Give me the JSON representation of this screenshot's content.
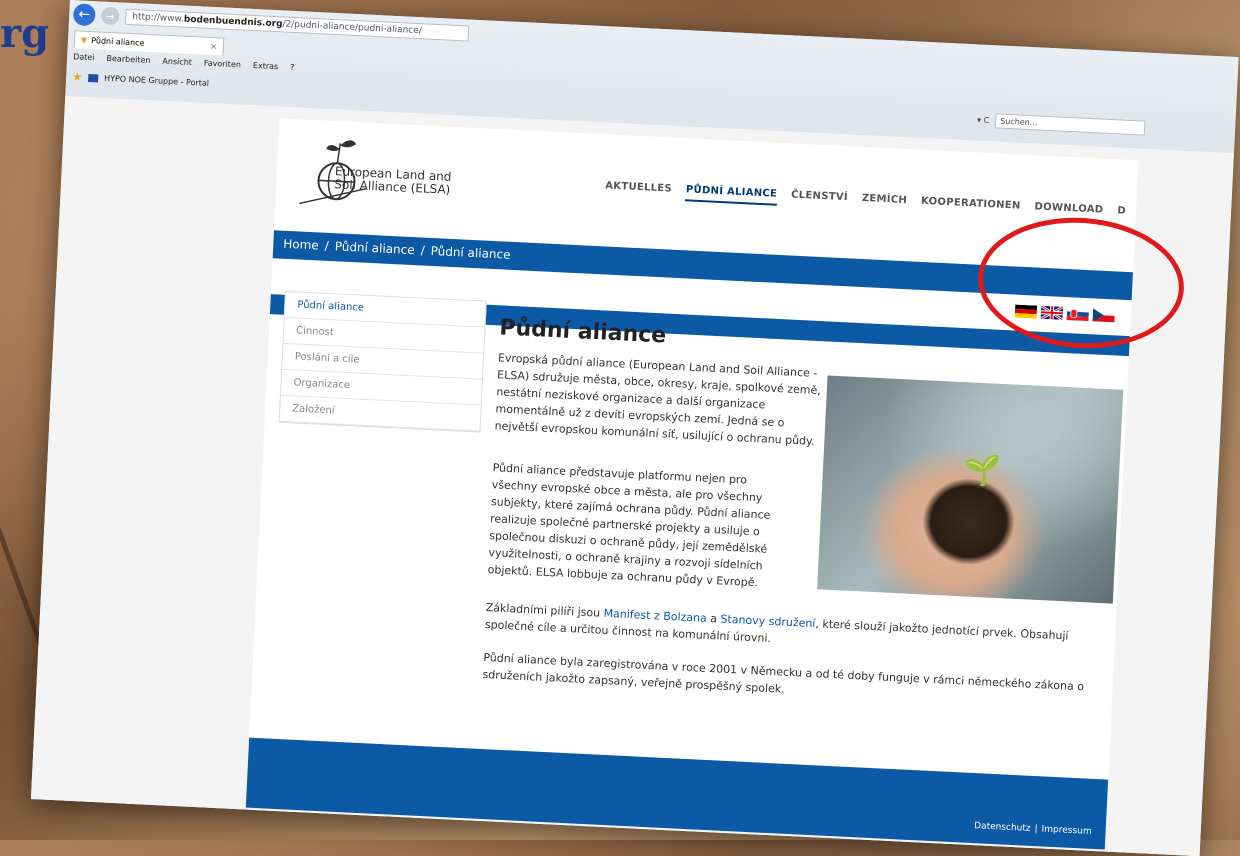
{
  "corner_text": "rg",
  "browser": {
    "url_prefix": "http://www.",
    "url_domain": "bodenbuendnis.org",
    "url_path": "/2/pudni-aliance/pudni-aliance/",
    "tab_title": "Půdní aliance",
    "tab_close": "×",
    "menu": [
      "Datei",
      "Bearbeiten",
      "Ansicht",
      "Favoriten",
      "Extras",
      "?"
    ],
    "favorite": "HYPO NOE Gruppe - Portal",
    "refresh": "▾ C",
    "search_placeholder": "Suchen..."
  },
  "site": {
    "logo_line1": "European Land and",
    "logo_line2": "Soil Alliance (ELSA)",
    "nav": [
      "AKTUELLES",
      "PŮDNÍ ALIANCE",
      "ČLENSTVÍ",
      "ZEMÍCH",
      "KOOPERATIONEN",
      "DOWNLOAD",
      "D"
    ],
    "breadcrumb": [
      "Home",
      "/",
      "Půdní aliance",
      "/",
      "Půdní aliance"
    ],
    "sidebar": [
      "Půdní aliance",
      "Činnost",
      "Poslání a cíle",
      "Organizace",
      "Založení"
    ],
    "heading": "Půdní aliance",
    "para1": "Evropská půdní aliance (European Land and Soil Alliance - ELSA) sdružuje města, obce, okresy, kraje, spolkové země, nestátní neziskové organizace a další organizace momentálně už z devíti evropských zemí. Jedná se o největší evropskou komunální síť, usilující o ochranu půdy.",
    "para2": "Půdní aliance představuje platformu nejen pro všechny evropské obce a města, ale pro všechny subjekty, které zajímá ochrana půdy. Půdní aliance realizuje společné partnerské projekty a usiluje o společnou diskuzi o ochraně půdy, její zemědělské využitelnosti, o ochraně krajiny a rozvoji sídelních objektů. ELSA lobbuje za ochranu půdy v Evropě.",
    "para3_pre": "Základními pilíři jsou ",
    "para3_link1": "Manifest z Bolzana",
    "para3_mid": " a ",
    "para3_link2": "Stanovy sdružení",
    "para3_post": ", které slouží jakožto jednotící prvek. Obsahují společné cíle a určitou činnost na komunální úrovni.",
    "para4": "Půdní aliance byla zaregistrována v roce 2001 v Německu a od té doby funguje v rámci německého zákona o sdruženích jakožto zapsaný, veřejně prospěšný spolek.",
    "footer_link1": "Datenschutz",
    "footer_sep": "|",
    "footer_link2": "Impressum"
  },
  "colors": {
    "primary_blue": "#0c5aa6",
    "highlight_red": "#e01a1a"
  }
}
